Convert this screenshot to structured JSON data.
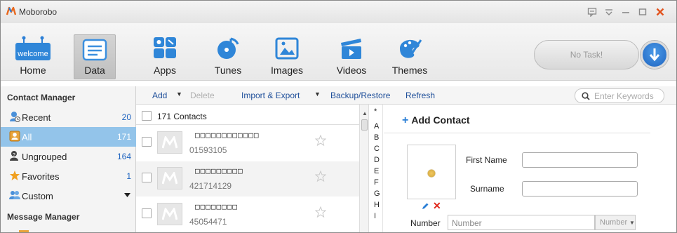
{
  "app": {
    "title": "Moboroboo",
    "title_display": "Moborobo",
    "accent": "#1f64c0",
    "selected_bg": "#93c4ea"
  },
  "window_controls": [
    "feedback-icon",
    "menu-icon",
    "minimize-icon",
    "maximize-icon",
    "close-icon"
  ],
  "toolbar": {
    "items": [
      {
        "label": "Home",
        "icon": "welcome-home-icon",
        "badge": "welcome"
      },
      {
        "label": "Data",
        "icon": "data-icon",
        "active": true
      },
      {
        "label": "Apps",
        "icon": "apps-icon"
      },
      {
        "label": "Tunes",
        "icon": "tunes-icon"
      },
      {
        "label": "Images",
        "icon": "images-icon"
      },
      {
        "label": "Videos",
        "icon": "videos-icon"
      },
      {
        "label": "Themes",
        "icon": "themes-icon"
      }
    ],
    "task_status": "No Task!"
  },
  "actions": {
    "add": "Add",
    "delete": "Delete",
    "import_export": "Import & Export",
    "backup_restore": "Backup/Restore",
    "refresh": "Refresh",
    "search_placeholder": "Enter Keywords"
  },
  "sidebar": {
    "contact_header": "Contact Manager",
    "message_header": "Message Manager",
    "items": [
      {
        "label": "Recent",
        "count": "20",
        "icon": "recent-contacts-icon"
      },
      {
        "label": "All",
        "count": "171",
        "icon": "all-contacts-icon",
        "selected": true
      },
      {
        "label": "Ungrouped",
        "count": "164",
        "icon": "ungrouped-icon"
      },
      {
        "label": "Favorites",
        "count": "1",
        "icon": "favorites-star-icon"
      },
      {
        "label": "Custom",
        "count": "",
        "icon": "custom-group-icon"
      }
    ]
  },
  "contacts": {
    "count_label": "171 Contacts",
    "rows": [
      {
        "name": "□□□□□□□□□□□□",
        "phone": "01593105"
      },
      {
        "name": "□□□□□□□□□",
        "phone": "421714129"
      },
      {
        "name": "□□□□□□□□",
        "phone": "45054471"
      }
    ],
    "alphabet": [
      "*",
      "A",
      "B",
      "C",
      "D",
      "E",
      "F",
      "G",
      "H",
      "I"
    ]
  },
  "detail": {
    "title": "Add Contact",
    "first_name_label": "First Name",
    "surname_label": "Surname",
    "number_label": "Number",
    "number_placeholder": "Number",
    "number_type": "Number"
  }
}
